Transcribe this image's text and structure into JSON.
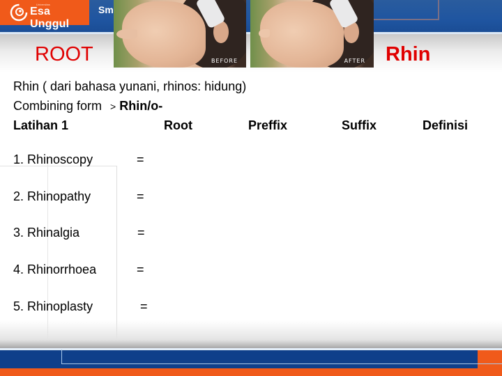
{
  "header": {
    "brand_name": "Esa Unggul",
    "brand_small_text": "Universitas",
    "tagline_partial": "Sm",
    "colors": {
      "orange": "#f05a1a",
      "blue": "#1f55a0",
      "footer_blue": "#0f3f8a"
    }
  },
  "photos": {
    "before_label": "BEFORE",
    "after_label": "AFTER"
  },
  "titles": {
    "left": "ROOT",
    "right": "Rhin",
    "color": "#e00000"
  },
  "intro": {
    "line1": "Rhin ( dari bahasa yunani, rhinos: hidung)",
    "line2_prefix": "Combining form",
    "line2_arrow": ">",
    "line2_bold": "Rhin/o-"
  },
  "table": {
    "headers": [
      "Latihan 1",
      "Root",
      "Preffix",
      "Suffix",
      "Definisi"
    ],
    "items": [
      {
        "label": "1. Rhinoscopy",
        "eq": "="
      },
      {
        "label": "2. Rhinopathy",
        "eq": "="
      },
      {
        "label": "3. Rhinalgia",
        "eq": "="
      },
      {
        "label": "4. Rhinorrhoea",
        "eq": "="
      },
      {
        "label": "5. Rhinoplasty",
        "eq": "="
      }
    ]
  }
}
